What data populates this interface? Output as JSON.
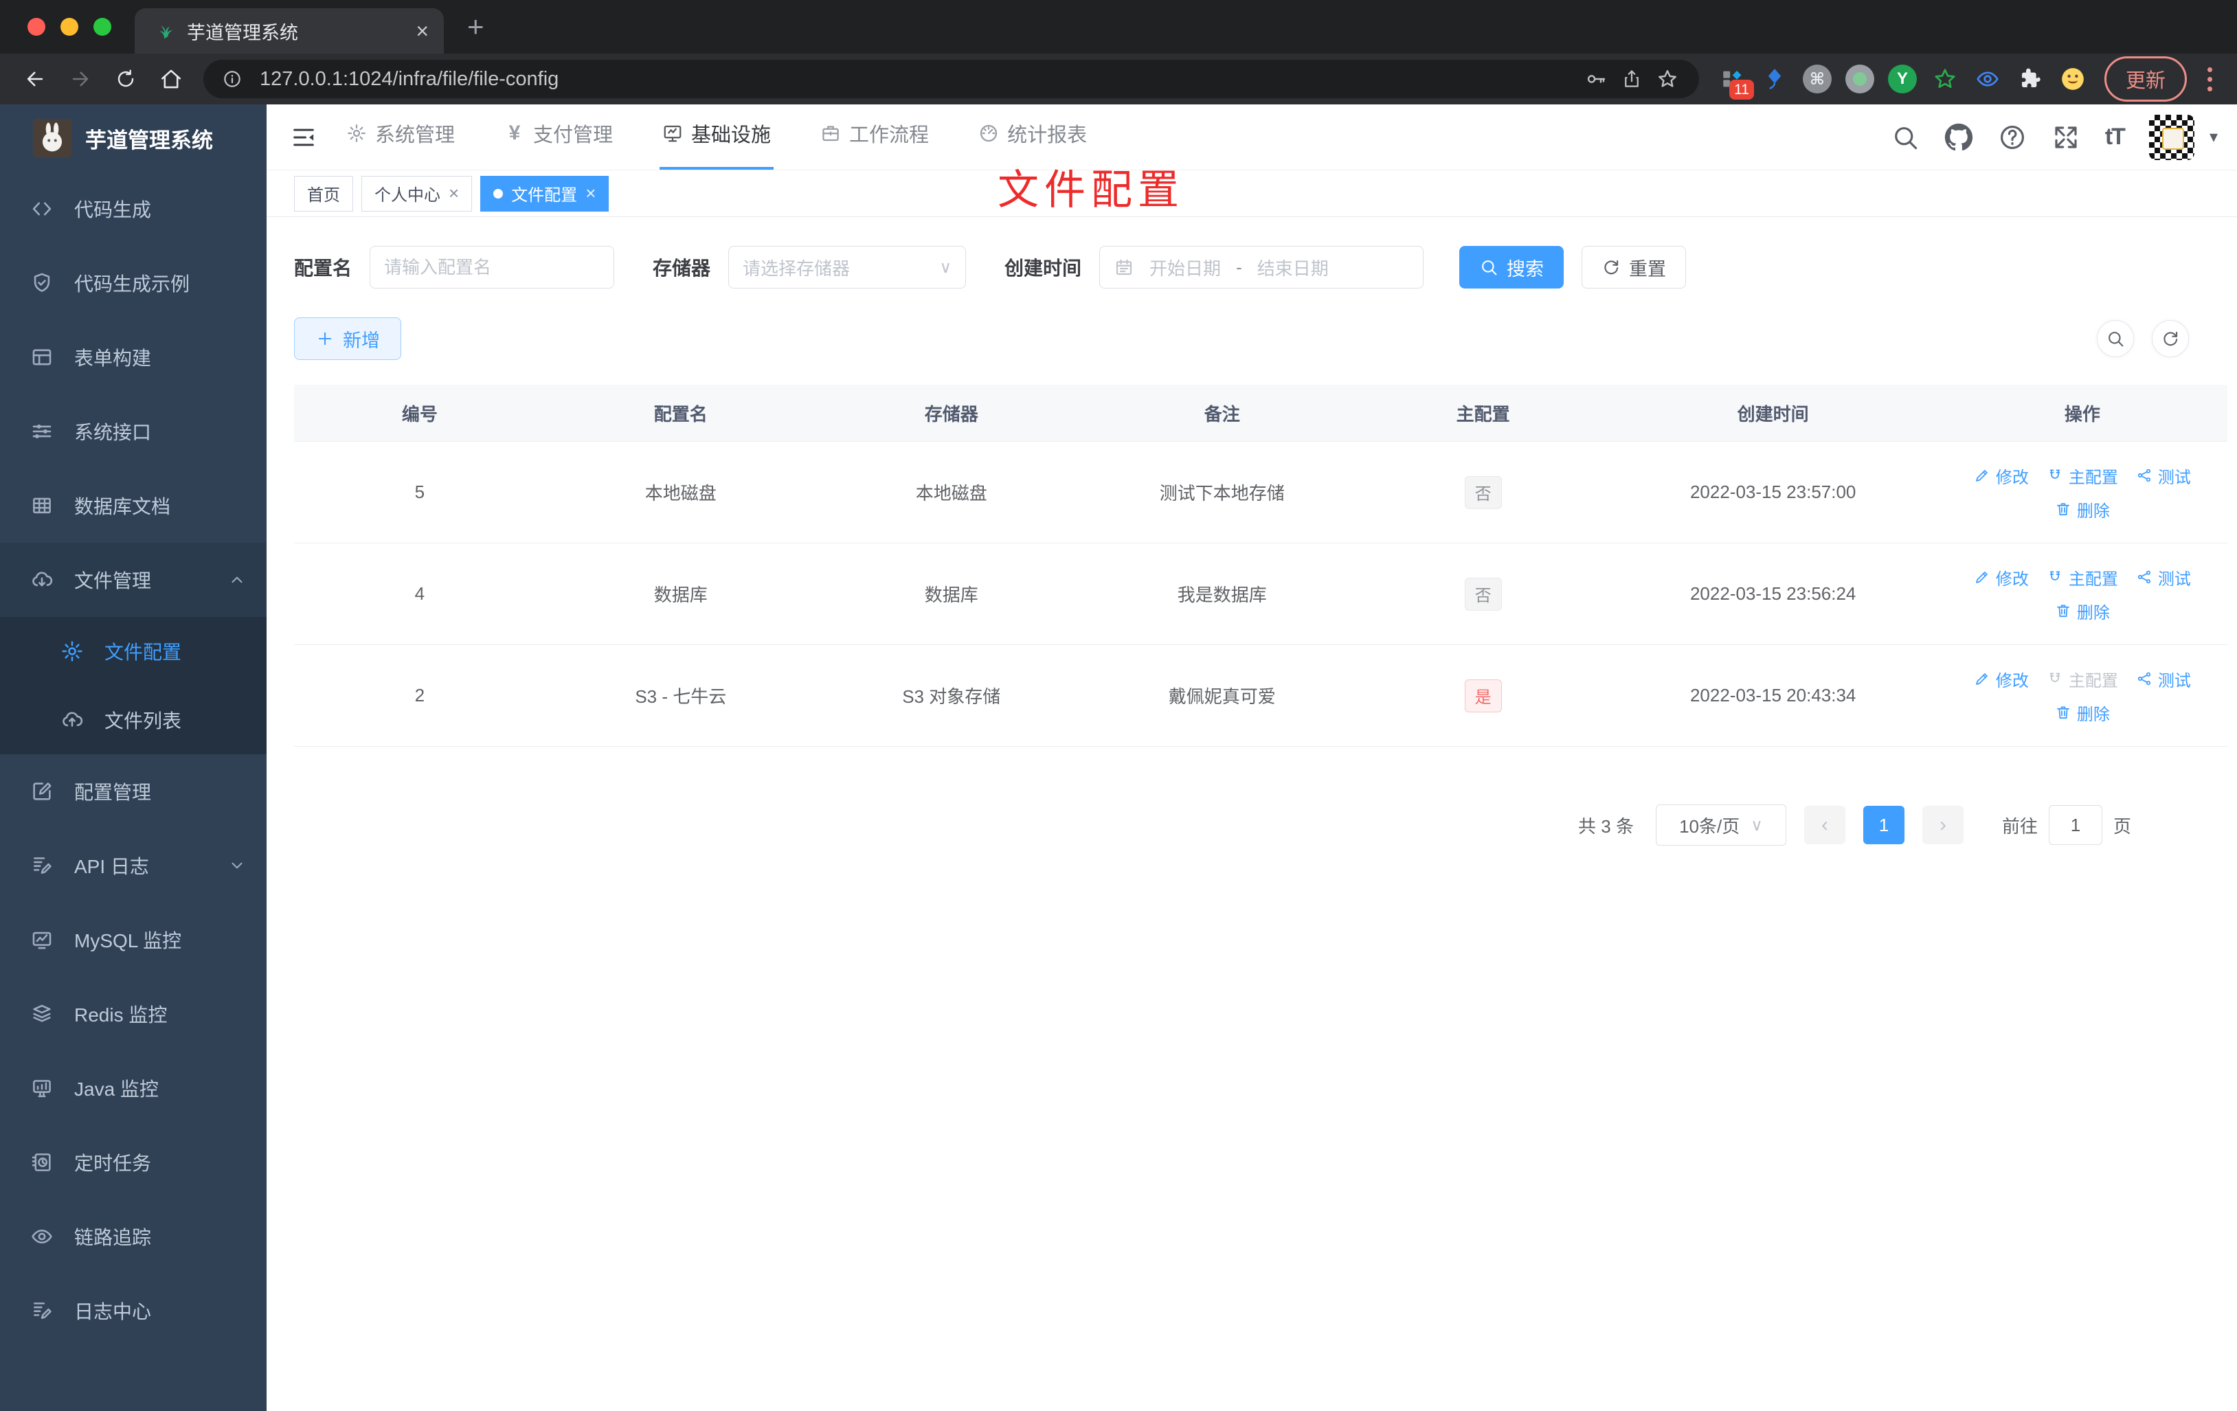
{
  "icons": {
    "close": "×",
    "plus": "+",
    "command": "⌘",
    "yen": "¥",
    "font_size": "tT",
    "caret_down": "▾",
    "select_caret": "∨",
    "prev": "‹",
    "next": "›",
    "dot": "●",
    "ext_y": "Y"
  },
  "browser": {
    "tab_title": "芋道管理系统",
    "url": "127.0.0.1:1024/infra/file/file-config",
    "update_label": "更新",
    "ext_badge": "11"
  },
  "header": {
    "menus": [
      "系统管理",
      "支付管理",
      "基础设施",
      "工作流程",
      "统计报表"
    ]
  },
  "sidebar": {
    "logo": "芋道管理系统",
    "items": [
      "代码生成",
      "代码生成示例",
      "表单构建",
      "系统接口",
      "数据库文档",
      "文件管理",
      "文件配置",
      "文件列表",
      "配置管理",
      "API 日志",
      "MySQL 监控",
      "Redis 监控",
      "Java 监控",
      "定时任务",
      "链路追踪",
      "日志中心"
    ]
  },
  "tags": [
    "首页",
    "个人中心",
    "文件配置"
  ],
  "annotation": "文件配置",
  "filters": {
    "name_label": "配置名",
    "name_placeholder": "请输入配置名",
    "storage_label": "存储器",
    "storage_placeholder": "请选择存储器",
    "date_label": "创建时间",
    "date_start": "开始日期",
    "date_separator": "-",
    "date_end": "结束日期",
    "search_label": "搜索",
    "reset_label": "重置",
    "add_label": "新增"
  },
  "table": {
    "headers": [
      "编号",
      "配置名",
      "存储器",
      "备注",
      "主配置",
      "创建时间",
      "操作"
    ],
    "rows": [
      {
        "id": "5",
        "name": "本地磁盘",
        "storage": "本地磁盘",
        "remark": "测试下本地存储",
        "master": "否",
        "created": "2022-03-15 23:57:00",
        "actions": {
          "edit": "修改",
          "master": "主配置",
          "test": "测试",
          "delete": "删除"
        }
      },
      {
        "id": "4",
        "name": "数据库",
        "storage": "数据库",
        "remark": "我是数据库",
        "master": "否",
        "created": "2022-03-15 23:56:24",
        "actions": {
          "edit": "修改",
          "master": "主配置",
          "test": "测试",
          "delete": "删除"
        }
      },
      {
        "id": "2",
        "name": "S3 - 七牛云",
        "storage": "S3 对象存储",
        "remark": "戴佩妮真可爱",
        "master": "是",
        "created": "2022-03-15 20:43:34",
        "actions": {
          "edit": "修改",
          "master": "主配置",
          "test": "测试",
          "delete": "删除"
        }
      }
    ]
  },
  "pagination": {
    "total": "共 3 条",
    "page_size": "10条/页",
    "page": "1",
    "goto_label": "前往",
    "goto_value": "1",
    "page_unit": "页"
  },
  "colors": {
    "accent": "#409eff",
    "danger": "#f56c6c",
    "info_tag": "#909399",
    "sidebar_bg": "#304156",
    "annotation_red": "#ee2b2b"
  }
}
